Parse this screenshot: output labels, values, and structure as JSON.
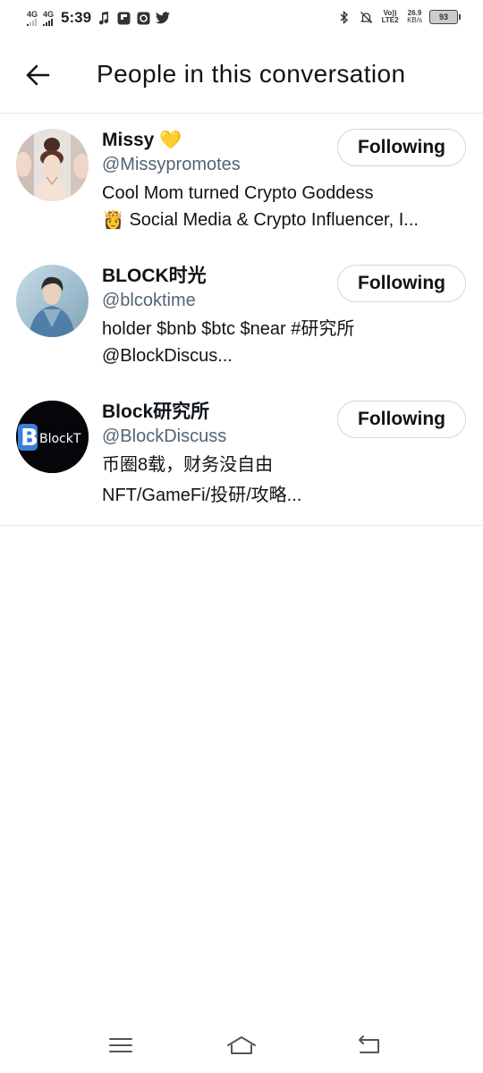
{
  "status_bar": {
    "net1": "4G",
    "net2": "4G",
    "time": "5:39",
    "volte": "Vo)) LTE2",
    "speed_value": "26.9",
    "speed_unit": "KB/s",
    "battery": "93",
    "notification_icons": [
      "music-note-icon",
      "flipboard-icon",
      "app-icon",
      "twitter-icon"
    ]
  },
  "header": {
    "title": "People in this conversation",
    "back_icon": "arrow-left-icon"
  },
  "people": [
    {
      "name": "Missy",
      "badge": "💛",
      "handle": "@Missypromotes",
      "bio_line1": "Cool Mom turned Crypto Goddess",
      "bio_line2": "👸 Social Media & Crypto Influencer, I...",
      "button": "Following"
    },
    {
      "name": "BLOCK时光",
      "badge": "",
      "handle": "@blcoktime",
      "bio_line1": "holder $bnb $btc $near #研究所",
      "bio_line2": "@BlockDiscus...",
      "button": "Following"
    },
    {
      "name": "Block研究所",
      "badge": "",
      "handle": "@BlockDiscuss",
      "bio_line1": "币圈8载，财务没自由",
      "bio_line2": "NFT/GameFi/投研/攻略...",
      "button": "Following",
      "avatar_text": "BlockT"
    }
  ],
  "colors": {
    "text": "#0f1419",
    "secondary": "#536471",
    "border": "#cfd9de",
    "divider": "#e4e8eb"
  }
}
